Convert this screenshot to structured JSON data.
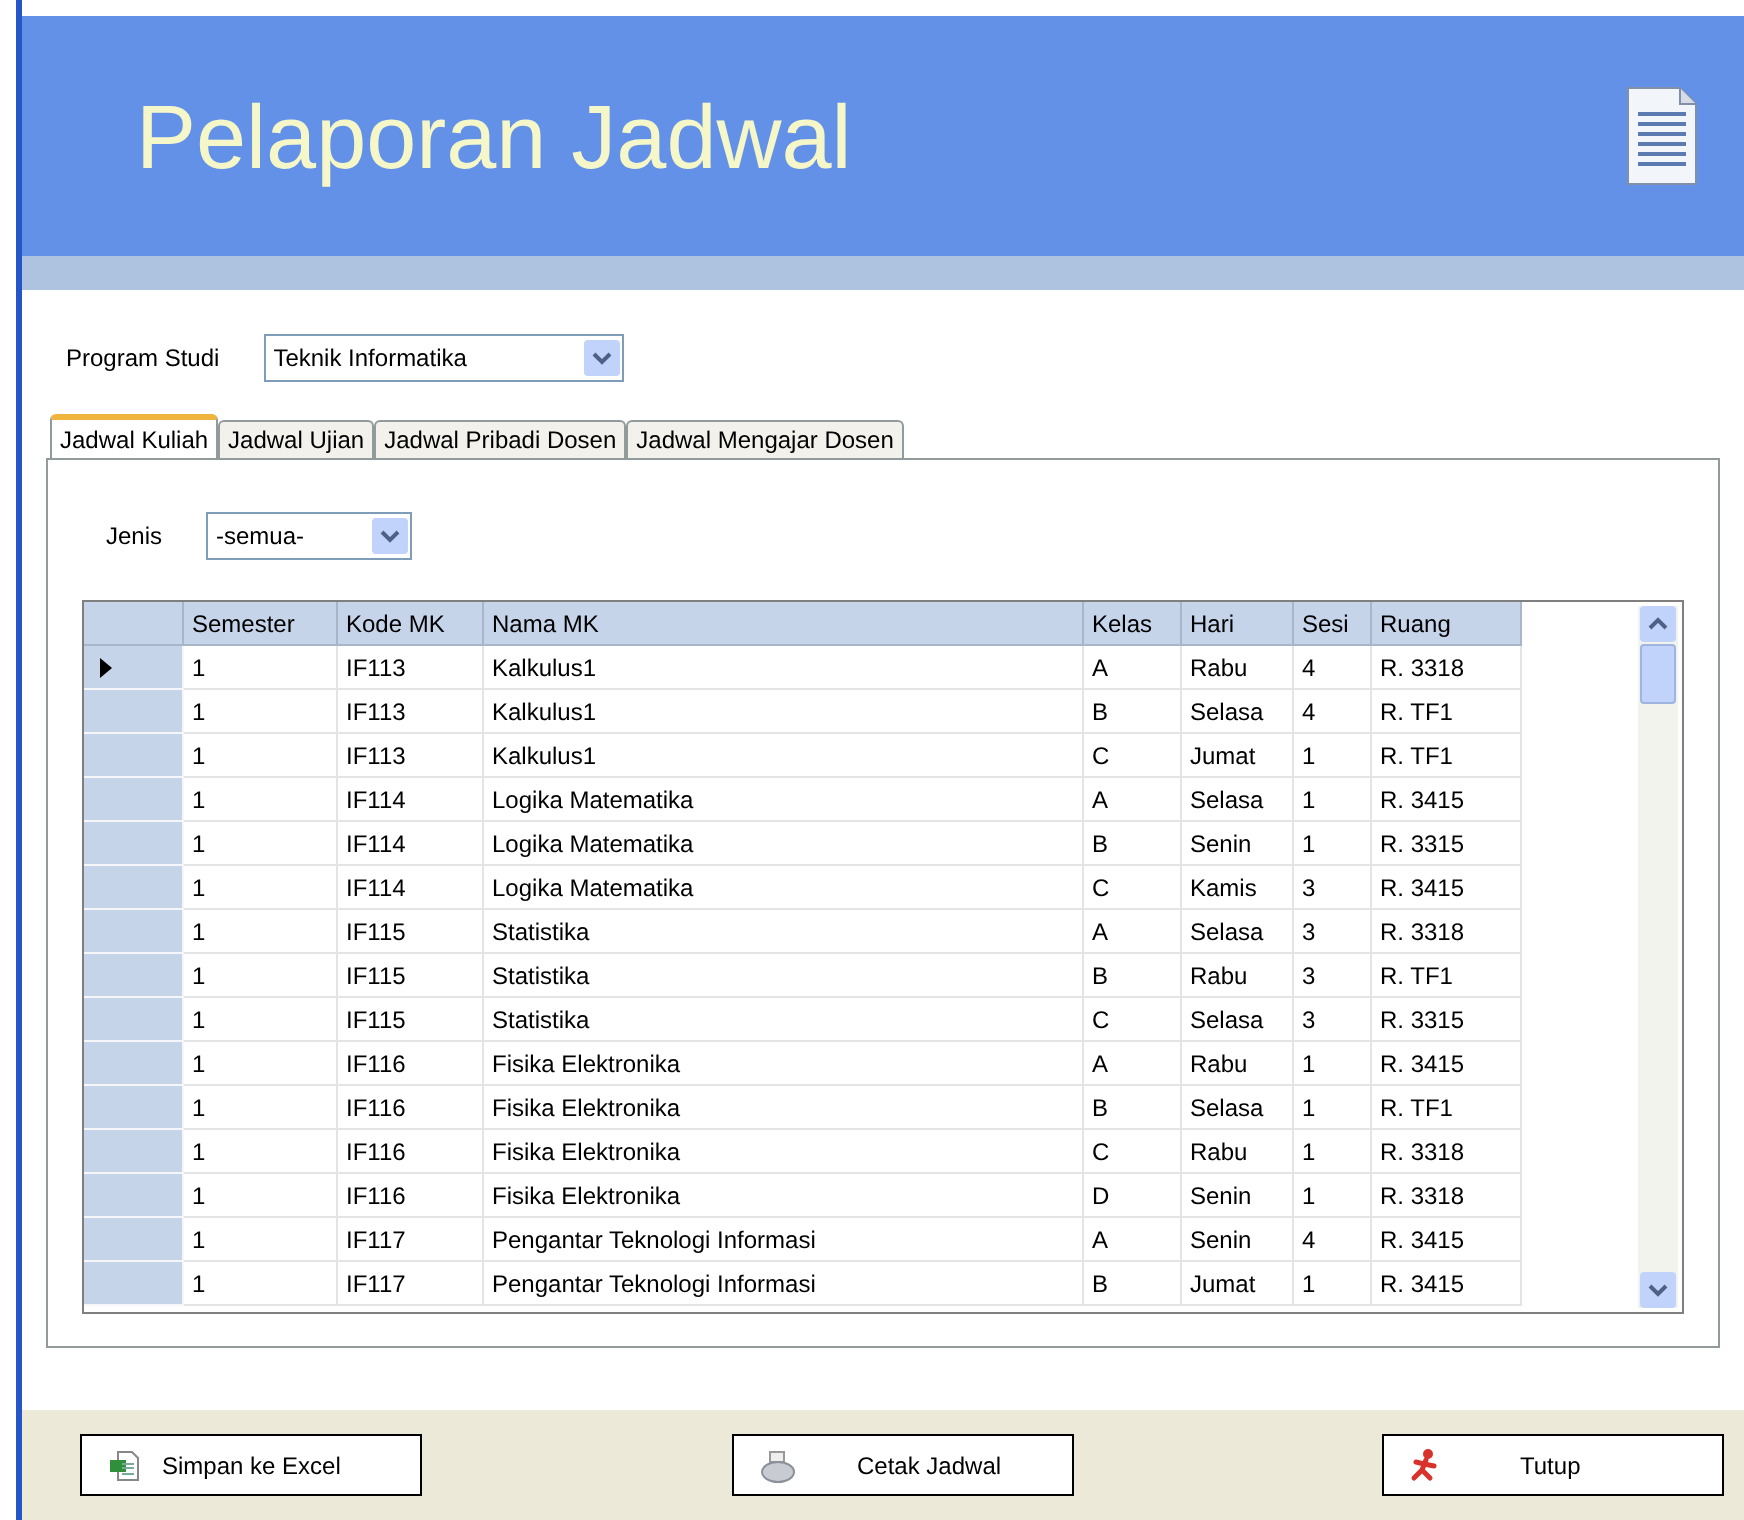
{
  "header": {
    "title": "Pelaporan Jadwal"
  },
  "program_studi": {
    "label": "Program Studi",
    "value": "Teknik Informatika"
  },
  "tabs": [
    {
      "label": "Jadwal Kuliah",
      "selected": true
    },
    {
      "label": "Jadwal Ujian",
      "selected": false
    },
    {
      "label": "Jadwal Pribadi Dosen",
      "selected": false
    },
    {
      "label": "Jadwal Mengajar Dosen",
      "selected": false
    }
  ],
  "jenis": {
    "label": "Jenis",
    "value": "-semua-"
  },
  "table": {
    "columns": [
      "Semester",
      "Kode MK",
      "Nama MK",
      "Kelas",
      "Hari",
      "Sesi",
      "Ruang"
    ],
    "rows": [
      {
        "selected": true,
        "cells": [
          "1",
          "IF113",
          "Kalkulus1",
          "A",
          "Rabu",
          "4",
          "R. 3318"
        ]
      },
      {
        "selected": false,
        "cells": [
          "1",
          "IF113",
          "Kalkulus1",
          "B",
          "Selasa",
          "4",
          "R. TF1"
        ]
      },
      {
        "selected": false,
        "cells": [
          "1",
          "IF113",
          "Kalkulus1",
          "C",
          "Jumat",
          "1",
          "R. TF1"
        ]
      },
      {
        "selected": false,
        "cells": [
          "1",
          "IF114",
          "Logika Matematika",
          "A",
          "Selasa",
          "1",
          "R. 3415"
        ]
      },
      {
        "selected": false,
        "cells": [
          "1",
          "IF114",
          "Logika Matematika",
          "B",
          "Senin",
          "1",
          "R. 3315"
        ]
      },
      {
        "selected": false,
        "cells": [
          "1",
          "IF114",
          "Logika Matematika",
          "C",
          "Kamis",
          "3",
          "R. 3415"
        ]
      },
      {
        "selected": false,
        "cells": [
          "1",
          "IF115",
          "Statistika",
          "A",
          "Selasa",
          "3",
          "R. 3318"
        ]
      },
      {
        "selected": false,
        "cells": [
          "1",
          "IF115",
          "Statistika",
          "B",
          "Rabu",
          "3",
          "R. TF1"
        ]
      },
      {
        "selected": false,
        "cells": [
          "1",
          "IF115",
          "Statistika",
          "C",
          "Selasa",
          "3",
          "R. 3315"
        ]
      },
      {
        "selected": false,
        "cells": [
          "1",
          "IF116",
          "Fisika Elektronika",
          "A",
          "Rabu",
          "1",
          "R. 3415"
        ]
      },
      {
        "selected": false,
        "cells": [
          "1",
          "IF116",
          "Fisika Elektronika",
          "B",
          "Selasa",
          "1",
          "R. TF1"
        ]
      },
      {
        "selected": false,
        "cells": [
          "1",
          "IF116",
          "Fisika Elektronika",
          "C",
          "Rabu",
          "1",
          "R. 3318"
        ]
      },
      {
        "selected": false,
        "cells": [
          "1",
          "IF116",
          "Fisika Elektronika",
          "D",
          "Senin",
          "1",
          "R. 3318"
        ]
      },
      {
        "selected": false,
        "cells": [
          "1",
          "IF117",
          "Pengantar Teknologi Informasi",
          "A",
          "Senin",
          "4",
          "R. 3415"
        ]
      },
      {
        "selected": false,
        "cells": [
          "1",
          "IF117",
          "Pengantar Teknologi Informasi",
          "B",
          "Jumat",
          "1",
          "R. 3415"
        ]
      }
    ]
  },
  "buttons": [
    {
      "kind": "excel",
      "label": "Simpan ke Excel"
    },
    {
      "kind": "print",
      "label": "Cetak Jadwal"
    },
    {
      "kind": "close",
      "label": "Tutup"
    }
  ]
}
